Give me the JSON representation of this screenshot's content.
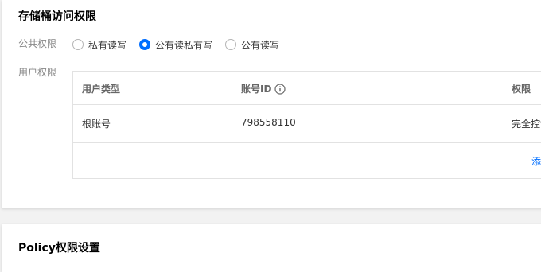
{
  "bucket_access": {
    "title": "存储桶访问权限",
    "public_permission": {
      "label": "公共权限",
      "options": [
        {
          "label": "私有读写",
          "checked": false
        },
        {
          "label": "公有读私有写",
          "checked": true
        },
        {
          "label": "公有读写",
          "checked": false
        }
      ]
    },
    "user_permission": {
      "label": "用户权限",
      "table": {
        "columns": [
          "用户类型",
          "账号ID",
          "权限"
        ],
        "rows": [
          {
            "user_type": "根账号",
            "account_id": "798558110",
            "permission": "完全控制"
          }
        ],
        "add_link": "添"
      }
    }
  },
  "policy": {
    "title": "Policy权限设置"
  },
  "colors": {
    "accent": "#006eff",
    "border": "#e2e2e2",
    "label": "#888888",
    "background": "#f2f2f2"
  }
}
